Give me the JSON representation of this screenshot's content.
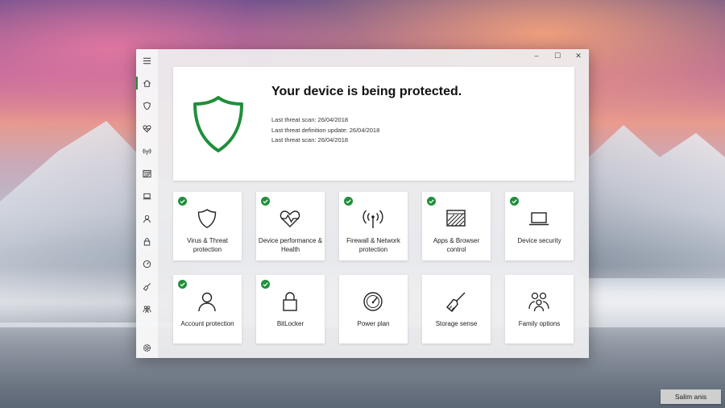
{
  "window": {
    "controls": [
      "–",
      "☐",
      "✕"
    ]
  },
  "sidebar": {
    "items": [
      {
        "icon": "menu-icon"
      },
      {
        "icon": "home-icon"
      },
      {
        "icon": "shield-icon"
      },
      {
        "icon": "heart-pulse-icon"
      },
      {
        "icon": "wifi-antenna-icon"
      },
      {
        "icon": "browser-app-icon"
      },
      {
        "icon": "laptop-icon"
      },
      {
        "icon": "person-icon"
      },
      {
        "icon": "lock-icon"
      },
      {
        "icon": "gauge-icon"
      },
      {
        "icon": "broom-icon"
      },
      {
        "icon": "family-icon"
      },
      {
        "icon": "gear-icon"
      }
    ]
  },
  "hero": {
    "title": "Your device is being protected.",
    "lines": [
      "Last threat scan: 26/04/2018",
      "Last threat definition update: 26/04/2018",
      "Last threat scan: 26/04/2018"
    ]
  },
  "tiles": [
    {
      "label": "Virus & Threat protection",
      "icon": "shield-icon",
      "checked": true
    },
    {
      "label": "Device performance & Health",
      "icon": "heart-pulse-icon",
      "checked": true
    },
    {
      "label": "Firewall & Network protection",
      "icon": "wifi-antenna-icon",
      "checked": true
    },
    {
      "label": "Apps & Browser control",
      "icon": "browser-app-icon",
      "checked": true
    },
    {
      "label": "Device security",
      "icon": "laptop-icon",
      "checked": true
    },
    {
      "label": "Account protection",
      "icon": "person-icon",
      "checked": true
    },
    {
      "label": "BitLocker",
      "icon": "lock-icon",
      "checked": true
    },
    {
      "label": "Power plan",
      "icon": "gauge-icon",
      "checked": false
    },
    {
      "label": "Storage sense",
      "icon": "broom-icon",
      "checked": false
    },
    {
      "label": "Family options",
      "icon": "family-icon",
      "checked": false
    }
  ],
  "taskbar": {
    "user_name": "Salim anis"
  },
  "colors": {
    "accent_green": "#1f8f3a"
  }
}
